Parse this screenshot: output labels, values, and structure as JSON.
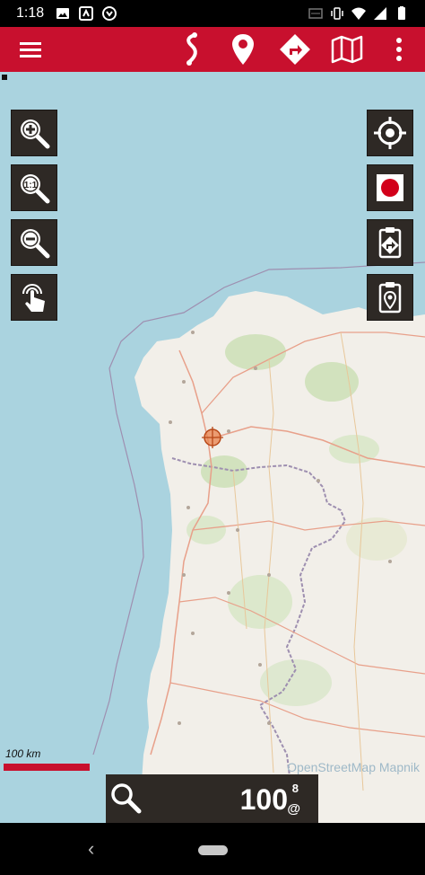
{
  "status_bar": {
    "time": "1:18",
    "left_icons": [
      "image-icon",
      "screenshot-icon",
      "download-icon"
    ],
    "right_icons": [
      "cast-icon",
      "vibrate-icon",
      "wifi-icon",
      "signal-icon",
      "battery-icon"
    ]
  },
  "toolbar": {
    "background": "#c8102e",
    "buttons": [
      "menu-icon",
      "route-icon",
      "location-pin-icon",
      "directions-icon",
      "map-icon",
      "more-vert-icon"
    ]
  },
  "map_controls": {
    "left": [
      "zoom-in-icon",
      "zoom-reset-icon",
      "zoom-out-icon",
      "touch-icon"
    ],
    "right": [
      "gps-target-icon",
      "record-icon",
      "clipboard-navigate-icon",
      "clipboard-pin-icon"
    ]
  },
  "map": {
    "scale_label": "100 km",
    "attribution": "OpenStreetMap Mapnik",
    "sea_color": "#aad3df",
    "land_color": "#f2efe9",
    "border_color": "#9e8fb0",
    "road_color": "#e8a08a"
  },
  "bottom_panel": {
    "zoom_level": "100",
    "superscript": "8",
    "suffix": "@"
  }
}
